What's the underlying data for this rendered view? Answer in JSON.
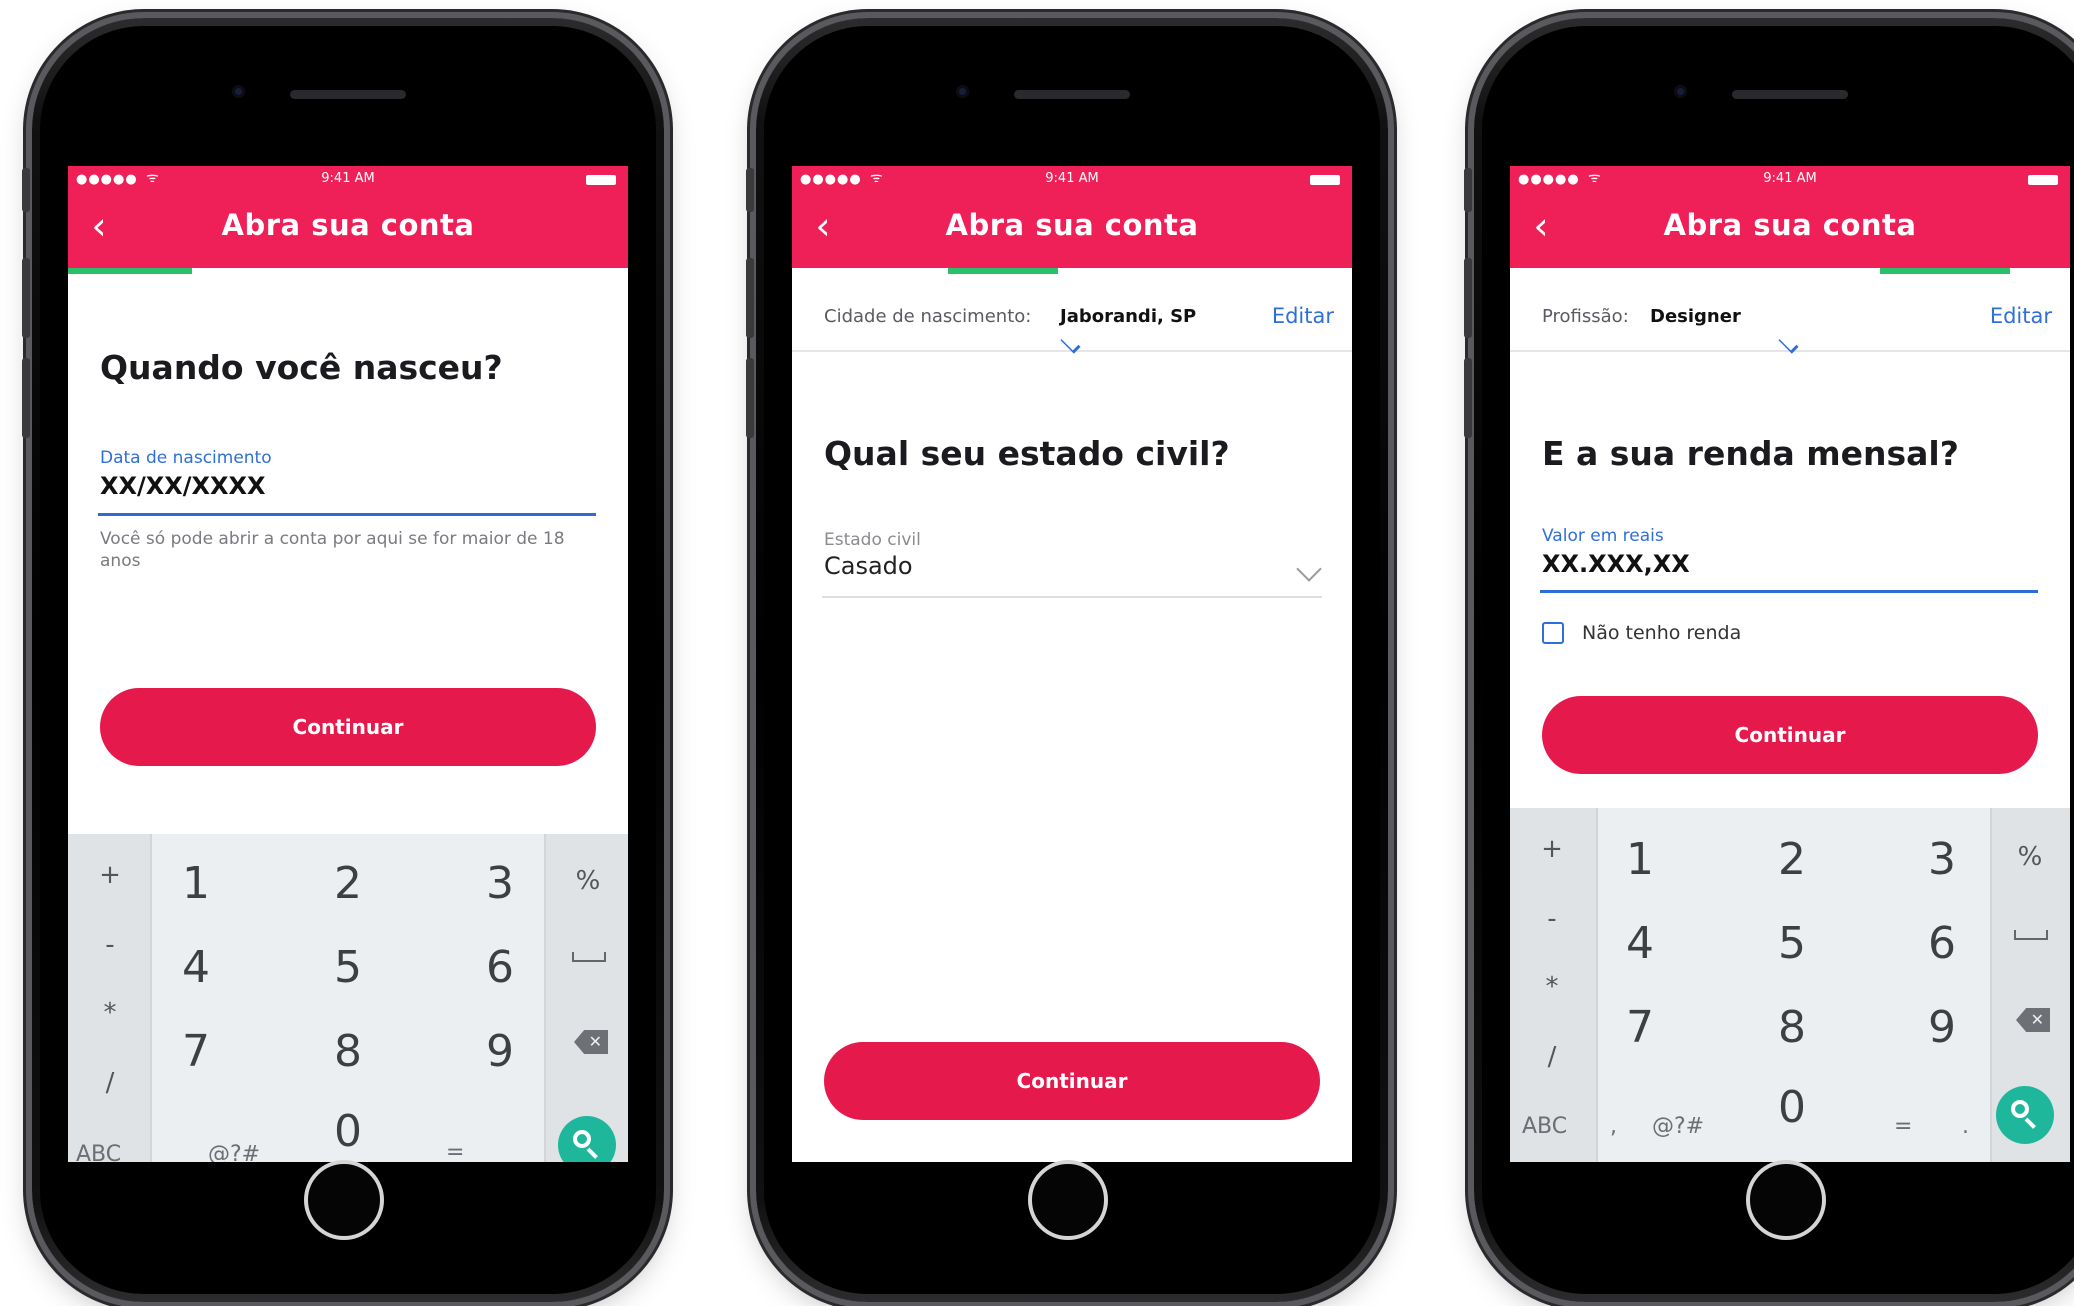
{
  "common": {
    "status_dots": "●●●●●",
    "status_time": "9:41 AM",
    "appbar_title": "Abra sua conta",
    "back_glyph": "‹"
  },
  "phone1": {
    "question": "Quando você nasceu?",
    "field_label": "Data de nascimento",
    "field_value": "XX/XX/XXXX",
    "helper": "Você só pode abrir a conta por aqui se for maior de 18 anos",
    "continue_label": "Continuar",
    "keyboard": {
      "left_symbols": [
        "+",
        "-",
        "*",
        "/"
      ],
      "digits": [
        "1",
        "2",
        "3",
        "4",
        "5",
        "6",
        "7",
        "8",
        "9",
        "0"
      ],
      "right_symbols": [
        "%"
      ],
      "bottom": [
        "ABC",
        "@?#",
        "="
      ]
    }
  },
  "phone2": {
    "summary_label": "Cidade de nascimento:",
    "summary_value": "Jaborandi, SP",
    "summary_edit": "Editar",
    "question": "Qual seu estado civil?",
    "select_label": "Estado civil",
    "select_value": "Casado",
    "continue_label": "Continuar"
  },
  "phone3": {
    "summary_label": "Profissão:",
    "summary_value": "Designer",
    "summary_edit": "Editar",
    "question": "E a sua renda mensal?",
    "field_label": "Valor em reais",
    "field_value": "XX.XXX,XX",
    "checkbox_label": "Não tenho renda",
    "continue_label": "Continuar",
    "keyboard": {
      "left_symbols": [
        "+",
        "-",
        "*",
        "/"
      ],
      "digits": [
        "1",
        "2",
        "3",
        "4",
        "5",
        "6",
        "7",
        "8",
        "9",
        "0"
      ],
      "right_symbols": [
        "%"
      ],
      "bottom": [
        "ABC",
        ",",
        "@?#",
        "=",
        "."
      ]
    }
  },
  "colors": {
    "brand_pink": "#ef1f57",
    "button_red": "#e5194b",
    "progress_green": "#2bbf6a",
    "link_blue": "#2f6fd8",
    "search_key_teal": "#1fb79c"
  }
}
